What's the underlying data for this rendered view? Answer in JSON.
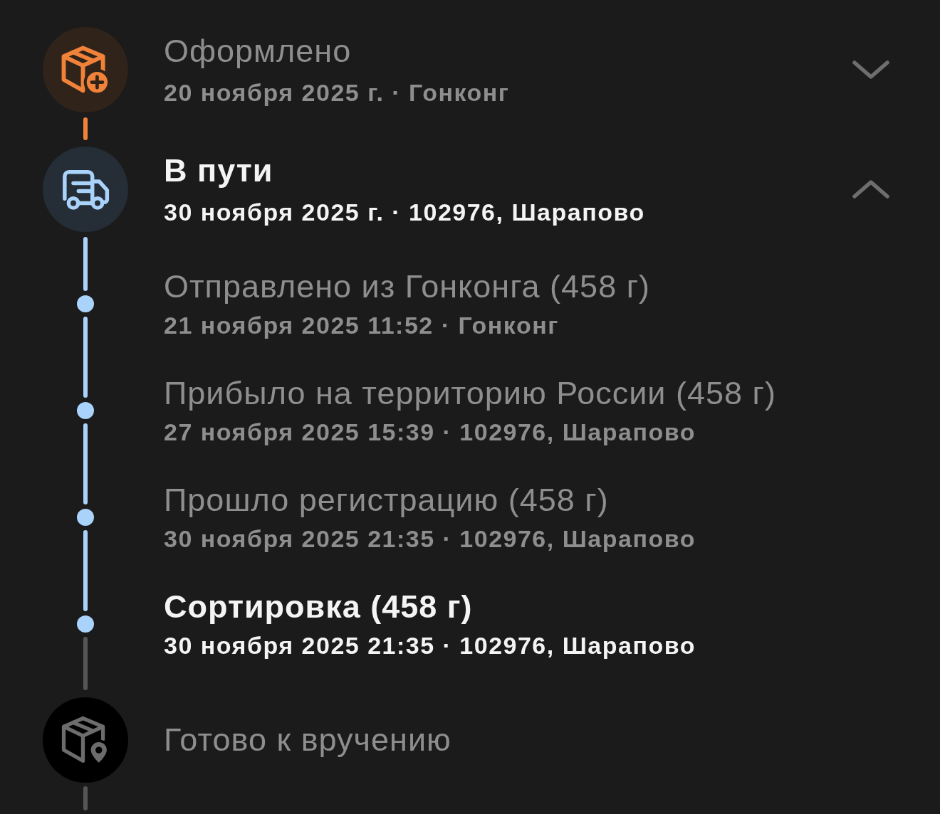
{
  "stages": [
    {
      "kind": "created",
      "reached": true,
      "current": false,
      "title": "Оформлено",
      "subtitle": "20 ноября 2025 г. · Гонконг",
      "expanded": false
    },
    {
      "kind": "transit",
      "reached": true,
      "current": true,
      "title": "В пути",
      "subtitle": "30 ноября 2025 г. · 102976, Шарапово",
      "expanded": true,
      "events": [
        {
          "title": "Отправлено из Гонконга (458 г)",
          "subtitle": "21 ноября 2025 11:52 · Гонконг",
          "current": false
        },
        {
          "title": "Прибыло на территорию России (458 г)",
          "subtitle": "27 ноября 2025 15:39 · 102976, Шарапово",
          "current": false
        },
        {
          "title": "Прошло регистрацию (458 г)",
          "subtitle": "30 ноября 2025 21:35 · 102976, Шарапово",
          "current": false
        },
        {
          "title": "Сортировка (458 г)",
          "subtitle": "30 ноября 2025 21:35 · 102976, Шарапово",
          "current": true
        }
      ]
    },
    {
      "kind": "ready",
      "reached": false,
      "current": false,
      "title": "Готово к вручению"
    }
  ]
}
